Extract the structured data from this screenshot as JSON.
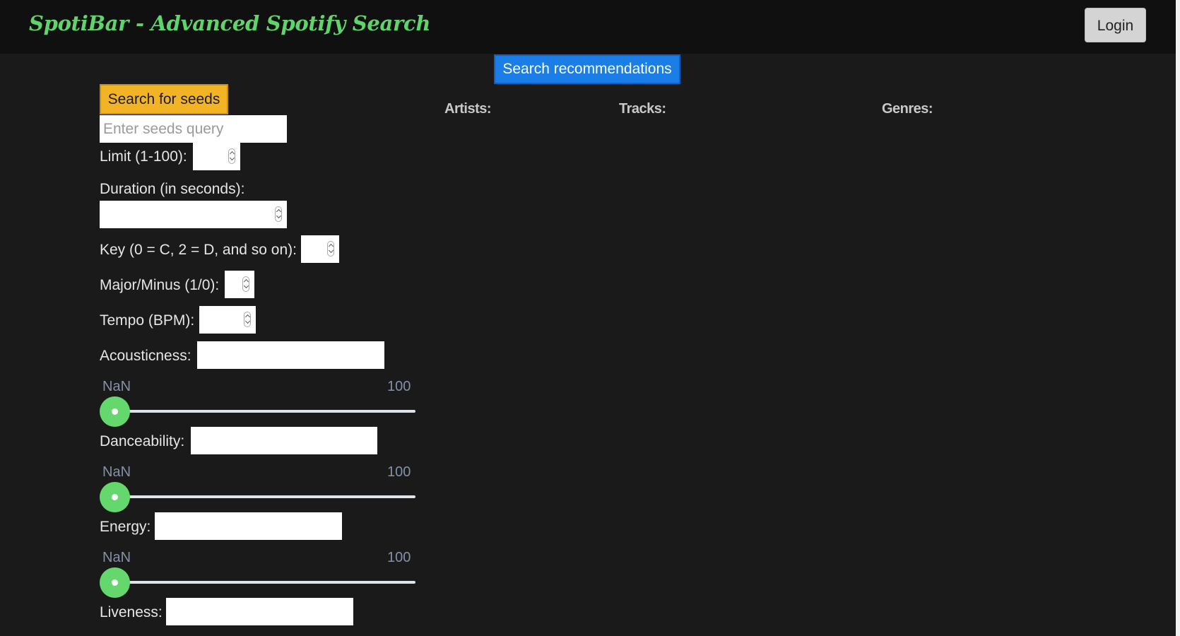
{
  "header": {
    "brand": "SpotiBar - Advanced Spotify Search",
    "login_label": "Login"
  },
  "actions": {
    "search_recommendations_label": "Search recommendations",
    "search_seeds_label": "Search for seeds"
  },
  "seeds": {
    "query_placeholder": "Enter seeds query",
    "query_value": ""
  },
  "results": {
    "artists_label": "Artists:",
    "tracks_label": "Tracks:",
    "genres_label": "Genres:"
  },
  "filters": {
    "limit_label": "Limit (1-100):",
    "limit_value": "",
    "duration_label": "Duration (in seconds):",
    "duration_value": "",
    "key_label": "Key (0 = C, 2 = D, and so on):",
    "key_value": "",
    "mode_label": "Major/Minus (1/0):",
    "mode_value": "",
    "tempo_label": "Tempo (BPM):",
    "tempo_value": "",
    "acousticness": {
      "label": "Acousticness:",
      "value": "",
      "range_min_text": "NaN",
      "range_max_text": "100",
      "slider_position": 0
    },
    "danceability": {
      "label": "Danceability:",
      "value": "",
      "range_min_text": "NaN",
      "range_max_text": "100",
      "slider_position": 0
    },
    "energy": {
      "label": "Energy:",
      "value": "",
      "range_min_text": "NaN",
      "range_max_text": "100",
      "slider_position": 0
    },
    "liveness": {
      "label": "Liveness:",
      "value": ""
    }
  },
  "colors": {
    "brand": "#5fd46a",
    "primary_button": "#1a7ee6",
    "seeds_button": "#f2b424",
    "slider_thumb": "#64d86c",
    "background": "#1a1a1a"
  }
}
